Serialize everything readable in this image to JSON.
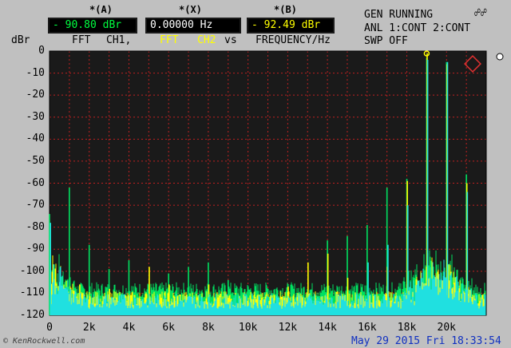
{
  "markers": {
    "a": {
      "title": "*(A)",
      "value": "- 90.80 dBr",
      "color": "#00ff40"
    },
    "x": {
      "title": "*(X)",
      "value": "0.00000 Hz",
      "color": "#ffffff"
    },
    "b": {
      "title": "*(B)",
      "value": "- 92.49 dBr",
      "color": "#ffff00"
    }
  },
  "trace_labels": {
    "fft1": "FFT",
    "ch1": "CH1,",
    "fft2": "FFT",
    "ch2": "CH2",
    "vs": "vs",
    "xaxis": "FREQUENCY/Hz",
    "yunit": "dBr",
    "ch1_color": "#000000",
    "ch2_color": "#ffff00"
  },
  "status": {
    "line1": "GEN RUNNING",
    "line2": "ANL 1:CONT 2:CONT",
    "line3": "SWP OFF",
    "icon": "rs-logo-icon"
  },
  "footer": {
    "watermark": "© KenRockwell.com",
    "datetime": "May 29 2015 Fri 18:33:54"
  },
  "chart_data": {
    "type": "line",
    "xlabel": "FREQUENCY/Hz",
    "ylabel": "dBr",
    "xlim": [
      0,
      22000
    ],
    "ylim": [
      -120,
      0
    ],
    "x_ticks": [
      "0",
      "2k",
      "4k",
      "6k",
      "8k",
      "10k",
      "12k",
      "14k",
      "16k",
      "18k",
      "20k"
    ],
    "y_ticks": [
      "0",
      "-10",
      "-20",
      "-30",
      "-40",
      "-50",
      "-60",
      "-70",
      "-80",
      "-90",
      "-100",
      "-110",
      "-120"
    ],
    "grid": true,
    "background": "#1a1a1a",
    "grid_color": "#c02020",
    "series": [
      {
        "color": "#00e060",
        "floor": -112,
        "peaks": [
          [
            0,
            -74
          ],
          [
            1000,
            -62
          ],
          [
            2000,
            -88
          ],
          [
            3000,
            -99
          ],
          [
            4000,
            -95
          ],
          [
            5000,
            -106
          ],
          [
            6000,
            -101
          ],
          [
            7000,
            -98
          ],
          [
            8000,
            -96
          ],
          [
            9000,
            -104
          ],
          [
            10000,
            -109
          ],
          [
            11000,
            -108
          ],
          [
            12000,
            -110
          ],
          [
            13000,
            -108
          ],
          [
            14000,
            -86
          ],
          [
            15000,
            -84
          ],
          [
            16000,
            -79
          ],
          [
            17000,
            -62
          ],
          [
            18000,
            -58
          ],
          [
            19000,
            -3
          ],
          [
            20000,
            -5
          ],
          [
            21000,
            -56
          ]
        ]
      },
      {
        "color": "#ffff00",
        "floor": -116,
        "peaks": [
          [
            1500,
            -106
          ],
          [
            3000,
            -108
          ],
          [
            5000,
            -98
          ],
          [
            6000,
            -106
          ],
          [
            8000,
            -106
          ],
          [
            12000,
            -107
          ],
          [
            13000,
            -96
          ],
          [
            14000,
            -92
          ],
          [
            15000,
            -103
          ],
          [
            17000,
            -98
          ],
          [
            18000,
            -59
          ],
          [
            19000,
            -1
          ],
          [
            20000,
            -6
          ],
          [
            21000,
            -60
          ]
        ]
      },
      {
        "color": "#20e0e0",
        "floor": -117,
        "peaks": [
          [
            0,
            -78
          ],
          [
            500,
            -98
          ],
          [
            1000,
            -108
          ],
          [
            1500,
            -110
          ],
          [
            16000,
            -96
          ],
          [
            17000,
            -88
          ],
          [
            18000,
            -70
          ],
          [
            19000,
            -4
          ],
          [
            20000,
            -5
          ],
          [
            21000,
            -64
          ]
        ]
      }
    ],
    "marker_cursor": {
      "x": 19000,
      "y": 0
    }
  }
}
